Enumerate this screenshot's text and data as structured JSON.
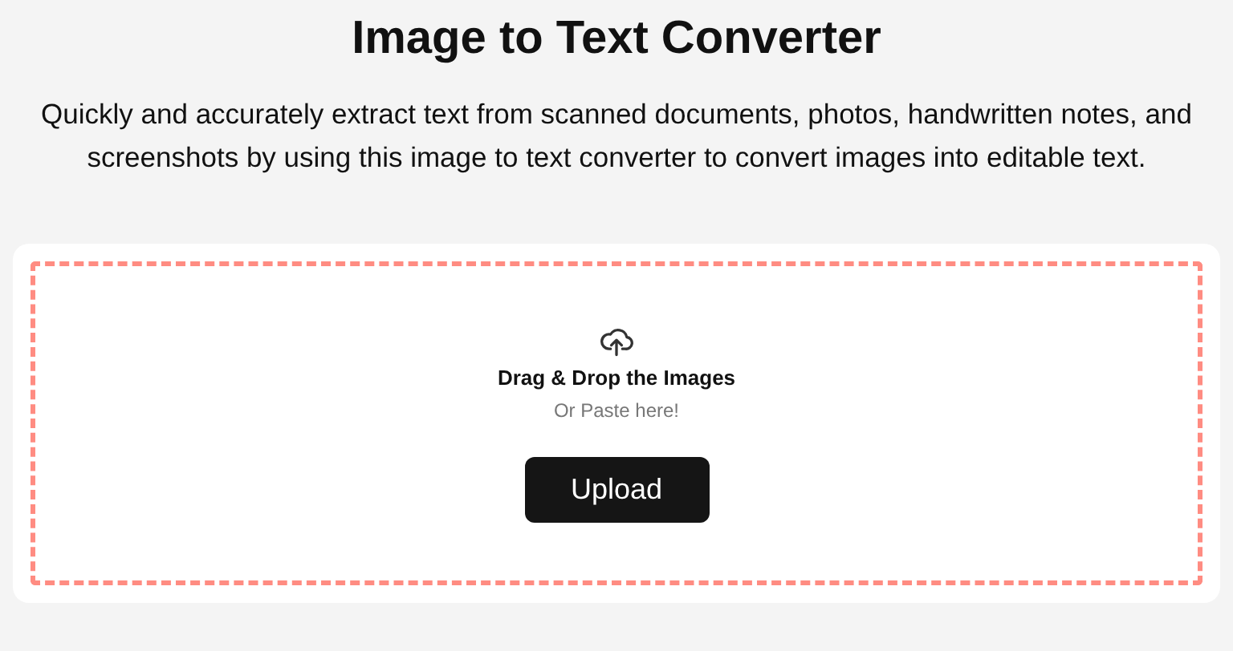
{
  "title": "Image to Text Converter",
  "description": "Quickly and accurately extract text from scanned documents, photos, handwritten notes, and screenshots by using this image to text converter to convert images into editable text.",
  "dropzone": {
    "heading": "Drag & Drop the Images",
    "hint": "Or Paste here!",
    "button": "Upload"
  }
}
